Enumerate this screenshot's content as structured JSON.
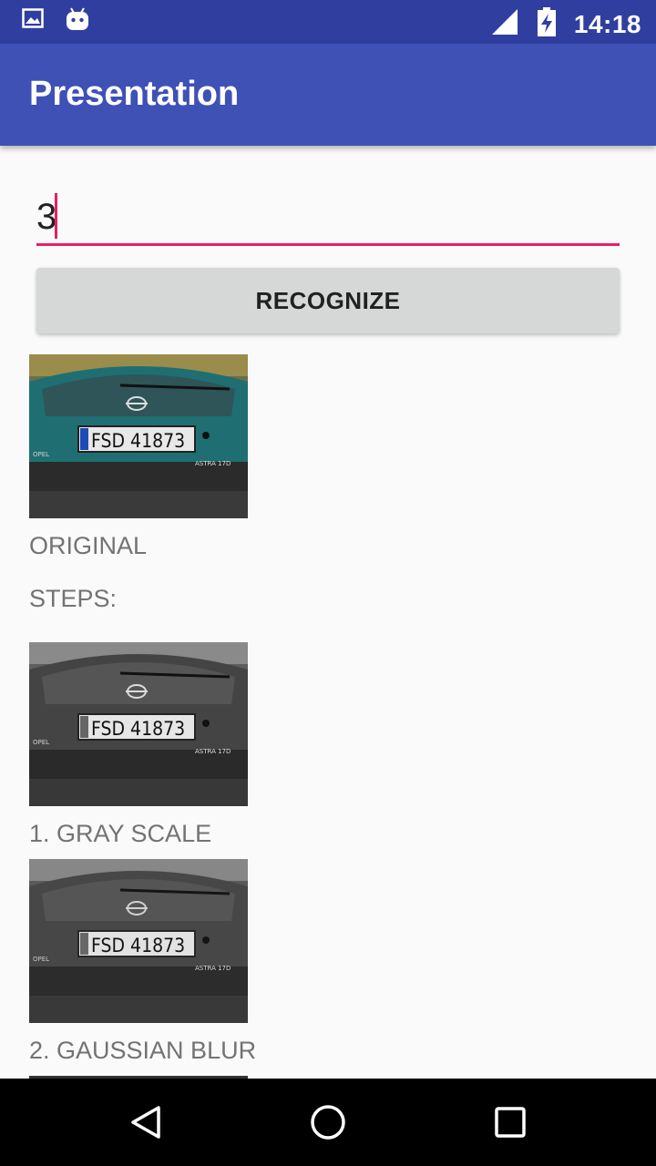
{
  "status_bar": {
    "time": "14:18",
    "left_icons": [
      "image-icon",
      "android-icon"
    ],
    "right_icons": [
      "signal-icon",
      "battery-charging-icon"
    ]
  },
  "app_bar": {
    "title": "Presentation"
  },
  "input": {
    "value": "3"
  },
  "recognize_button": {
    "label": "RECOGNIZE"
  },
  "images": [
    {
      "caption": "ORIGINAL",
      "plate": "FSD 41873",
      "style": "color"
    },
    {
      "caption": "1. GRAY SCALE",
      "plate": "FSD 41873",
      "style": "gray"
    },
    {
      "caption": "2. GAUSSIAN BLUR",
      "plate": "FSD 41873",
      "style": "gray"
    }
  ],
  "steps_label": "STEPS:",
  "car_text": {
    "brand": "OPEL",
    "model": "ASTRA 17D"
  },
  "nav_bar": {
    "icons": [
      "back-icon",
      "home-icon",
      "recents-icon"
    ]
  },
  "colors": {
    "status_bar": "#303f9f",
    "app_bar": "#3f51b5",
    "accent": "#e91e63"
  }
}
